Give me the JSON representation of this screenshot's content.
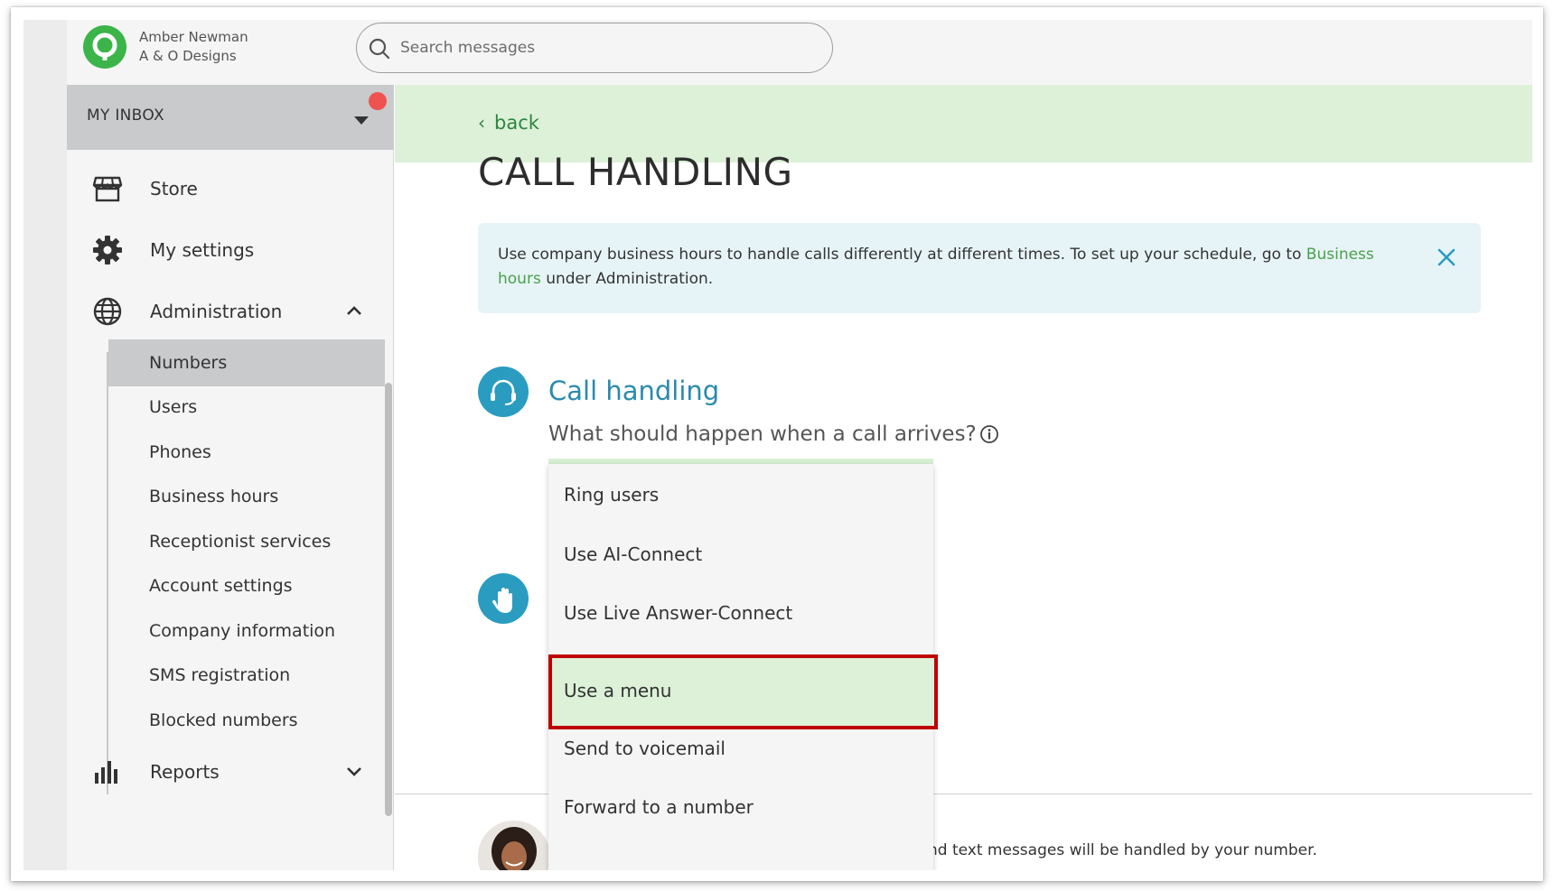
{
  "account": {
    "name": "Amber Newman",
    "company": "A & O Designs"
  },
  "search": {
    "placeholder": "Search messages"
  },
  "sidebar": {
    "inbox_label": "MY INBOX",
    "items": [
      {
        "label": "Store",
        "icon": "store-icon"
      },
      {
        "label": "My settings",
        "icon": "gear-icon"
      },
      {
        "label": "Administration",
        "icon": "globe-icon",
        "expanded": true
      }
    ],
    "admin_subitems": [
      {
        "label": "Numbers",
        "active": true
      },
      {
        "label": "Users"
      },
      {
        "label": "Phones"
      },
      {
        "label": "Business hours"
      },
      {
        "label": "Receptionist services"
      },
      {
        "label": "Account settings"
      },
      {
        "label": "Company information"
      },
      {
        "label": "SMS registration"
      },
      {
        "label": "Blocked numbers"
      }
    ],
    "reports_label": "Reports"
  },
  "main": {
    "back_label": "back",
    "page_title": "CALL HANDLING",
    "info": {
      "text_before": "Use company business hours to handle calls differently at different times. To set up your schedule, go to ",
      "link_text": "Business hours",
      "text_after": " under Administration."
    },
    "section": {
      "title": "Call handling",
      "question": "What should happen when a call arrives?"
    },
    "bottom_text": "nd text messages will be handled by your number."
  },
  "dropdown": {
    "options": [
      {
        "label": "Ring users"
      },
      {
        "label": "Use AI-Connect"
      },
      {
        "label": "Use Live Answer-Connect"
      },
      {
        "label": "Use a menu",
        "highlighted": true
      },
      {
        "label": "Send to voicemail"
      },
      {
        "label": "Forward to a number"
      }
    ]
  },
  "colors": {
    "brand_green": "#3bb54a",
    "accent_teal": "#2a9cc0",
    "highlight_green": "#dcf1d8",
    "notification_red": "#ef5350",
    "outline_red": "#c00000"
  }
}
